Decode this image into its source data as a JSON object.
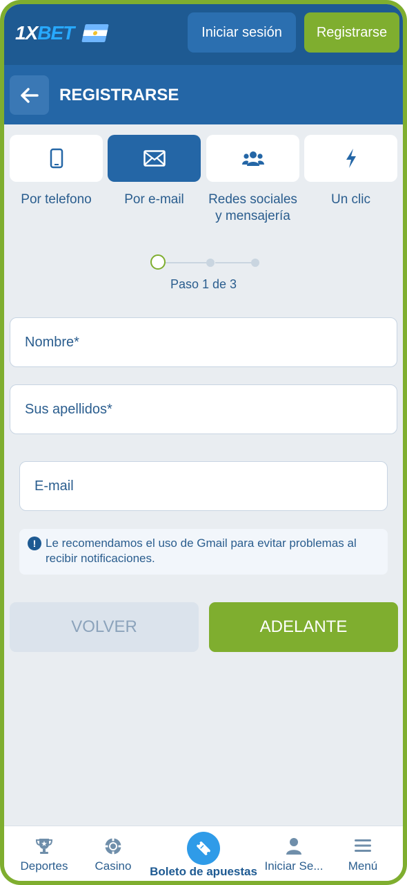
{
  "header": {
    "logo_text_1x": "1X",
    "logo_text_bet": "BET",
    "login_label": "Iniciar sesión",
    "register_label": "Registrarse"
  },
  "titlebar": {
    "back_icon": "arrow-left-icon",
    "title": "REGISTRARSE"
  },
  "methods": [
    {
      "icon": "phone-icon",
      "label": "Por telefono",
      "active": false
    },
    {
      "icon": "envelope-icon",
      "label": "Por e-mail",
      "active": true
    },
    {
      "icon": "users-icon",
      "label_line1": "Redes sociales",
      "label_line2": "y mensajería",
      "active": false
    },
    {
      "icon": "lightning-icon",
      "label": "Un clic",
      "active": false
    }
  ],
  "progress": {
    "current_step": 1,
    "total_steps": 3,
    "text": "Paso 1 de 3"
  },
  "form": {
    "first_name_placeholder": "Nombre*",
    "last_name_placeholder": "Sus apellidos*",
    "email_placeholder": "E-mail",
    "notice": "Le recomendamos el uso de Gmail para evitar problemas al recibir notificaciones."
  },
  "actions": {
    "back_label": "VOLVER",
    "next_label": "ADELANTE"
  },
  "bottom_nav": [
    {
      "icon": "trophy-icon",
      "label": "Deportes"
    },
    {
      "icon": "casino-chip-icon",
      "label": "Casino"
    },
    {
      "icon": "ticket-icon",
      "label": "Boleto de apuestas"
    },
    {
      "icon": "user-icon",
      "label": "Iniciar Se..."
    },
    {
      "icon": "menu-icon",
      "label": "Menú"
    }
  ],
  "colors": {
    "brand_blue": "#1e5a92",
    "accent_green": "#7fae2f",
    "text_blue": "#2a5d8e",
    "background": "#e9edf1"
  }
}
